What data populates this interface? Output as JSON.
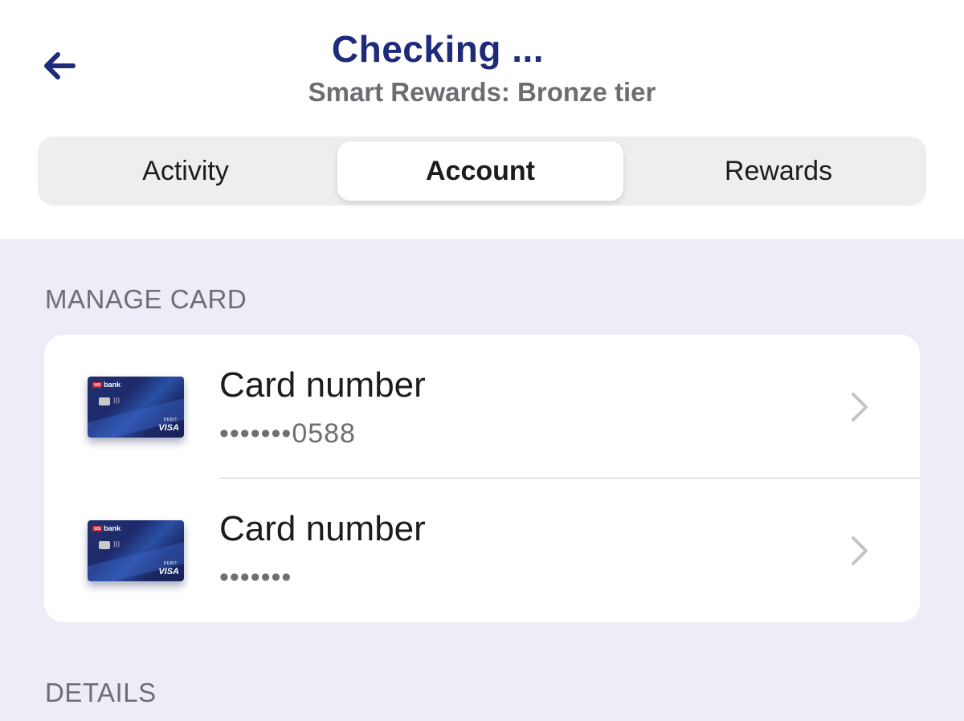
{
  "header": {
    "title": "Checking ...",
    "subtitle": "Smart Rewards: Bronze tier",
    "back_icon": "arrow-left-icon"
  },
  "tabs": [
    {
      "label": "Activity",
      "selected": false
    },
    {
      "label": "Account",
      "selected": true
    },
    {
      "label": "Rewards",
      "selected": false
    }
  ],
  "sections": {
    "manage_card_label": "MANAGE CARD",
    "details_label": "DETAILS"
  },
  "cards": [
    {
      "title": "Card number",
      "number": "•••••••0588",
      "bank_logo": "bank",
      "bank_logo_prefix": "us",
      "card_type": "DEBIT",
      "network": "VISA"
    },
    {
      "title": "Card number",
      "number": "•••••••",
      "bank_logo": "bank",
      "bank_logo_prefix": "us",
      "card_type": "DEBIT",
      "network": "VISA"
    }
  ],
  "colors": {
    "title": "#1d2b7a",
    "subtitle": "#6d6d72",
    "content_background": "#ecedf6",
    "segmented_background": "#eeeef0"
  }
}
